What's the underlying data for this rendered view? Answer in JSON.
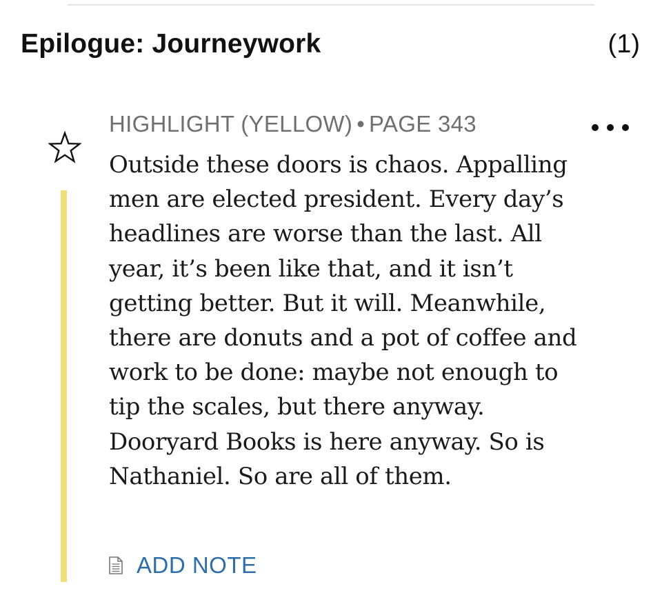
{
  "section": {
    "title": "Epilogue: Journeywork",
    "count": "(1)"
  },
  "highlight": {
    "type_label": "HIGHLIGHT (YELLOW)",
    "separator": "•",
    "page_label": "PAGE 343",
    "color": "#efe07a",
    "text": "Outside these doors is chaos. Appalling men are elected president. Every day’s headlines are worse than the last. All year, it’s been like that, and it isn’t getting better. But it will. Meanwhile, there are donuts and a pot of coffee and work to be done: maybe not enough to tip the scales, but there anyway. Dooryard Books is here anyway. So is Nathaniel. So are all of them.",
    "star_icon": "star-outline-icon",
    "more_icon": "more-horizontal-icon"
  },
  "note_action": {
    "label": "ADD NOTE",
    "icon": "document-icon",
    "color": "#2e6da8"
  }
}
